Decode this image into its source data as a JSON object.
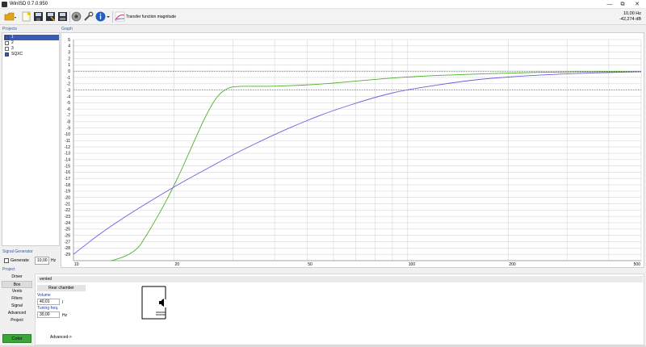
{
  "window": {
    "title": "WinISD 0.7.0.950",
    "minimize": "—",
    "restore": "⧉",
    "close": "✕"
  },
  "toolbar": {
    "view_label": "Transfer function magnitude"
  },
  "readout": {
    "freq": "10,00 Hz",
    "level": "-42,274 dB"
  },
  "projects": {
    "title": "Projects",
    "items": [
      {
        "label": "1",
        "checked": true,
        "selected": true
      },
      {
        "label": "2",
        "checked": false,
        "selected": false
      },
      {
        "label": "3",
        "checked": false,
        "selected": false
      },
      {
        "label": "SQXC",
        "checked": true,
        "selected": false
      }
    ]
  },
  "graph": {
    "title": "Graph"
  },
  "signal_generator": {
    "title": "Signal Generator",
    "generate_label": "Generate",
    "freq_value": "10,00",
    "freq_unit": "Hz"
  },
  "project_nav": {
    "title": "Project",
    "items": [
      "Driver",
      "Box",
      "Vents",
      "Filters",
      "Signal",
      "Advanced",
      "Project"
    ],
    "selected": "Box",
    "color_button": "Color"
  },
  "box": {
    "type": "vented",
    "tab": "Rear chamber",
    "volume_label": "Volume",
    "volume_value": "40,01",
    "volume_unit": "l",
    "tuning_label": "Tuning freq.",
    "tuning_value": "30,00",
    "tuning_unit": "Hz",
    "advanced_label": "Advanced->"
  },
  "chart_data": {
    "type": "line",
    "x_scale": "log",
    "xlim": [
      10,
      500
    ],
    "ylim": [
      -30,
      5
    ],
    "x_ticks": [
      10,
      20,
      50,
      100,
      200,
      500
    ],
    "y_ticks": [
      5,
      4,
      3,
      2,
      1,
      0,
      -1,
      -2,
      -3,
      -4,
      -5,
      -6,
      -7,
      -8,
      -9,
      -10,
      -11,
      -12,
      -13,
      -14,
      -15,
      -16,
      -17,
      -18,
      -19,
      -20,
      -21,
      -22,
      -23,
      -24,
      -25,
      -26,
      -27,
      -28,
      -29
    ],
    "reference_lines": [
      0,
      -3
    ],
    "grid": true,
    "series": [
      {
        "color": "#4caf2a",
        "x": [
          10,
          15,
          17,
          19,
          21,
          23,
          25,
          27,
          29,
          31,
          33,
          36,
          40,
          50,
          60,
          80,
          100,
          150,
          200,
          300,
          500
        ],
        "y": [
          -31,
          -29.5,
          -25,
          -20.5,
          -15.8,
          -11,
          -6.8,
          -3.8,
          -2.6,
          -2.4,
          -2.4,
          -2.4,
          -2.4,
          -2.2,
          -1.9,
          -1.3,
          -0.9,
          -0.5,
          -0.3,
          -0.1,
          -0.1
        ]
      },
      {
        "color": "#6f5ce0",
        "x": [
          10,
          12,
          15,
          20,
          25,
          30,
          40,
          50,
          60,
          80,
          100,
          150,
          200,
          300,
          500
        ],
        "y": [
          -29,
          -25.7,
          -22.3,
          -18.3,
          -15.5,
          -13.2,
          -10,
          -7.8,
          -6.2,
          -4.1,
          -2.9,
          -1.5,
          -0.9,
          -0.4,
          -0.1
        ]
      }
    ]
  }
}
